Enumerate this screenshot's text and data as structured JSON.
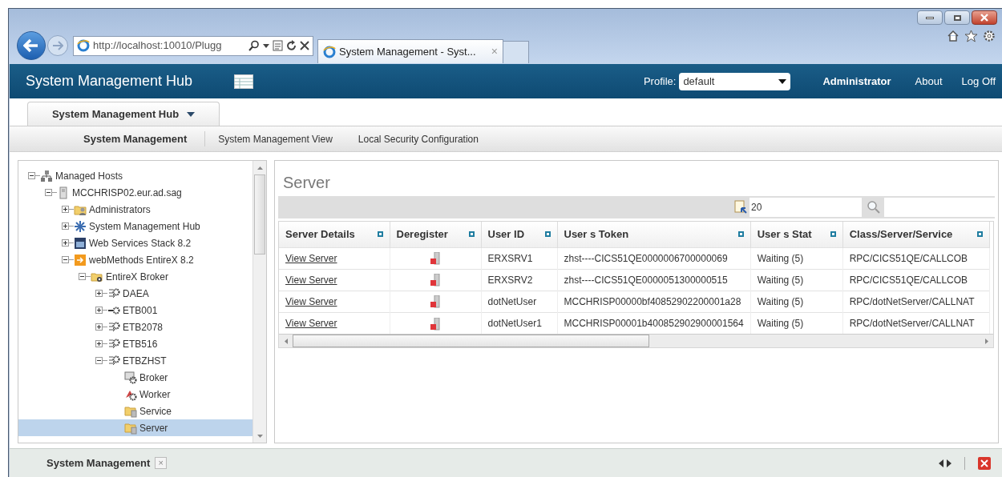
{
  "browser": {
    "address": "http://localhost:10010/Plugg",
    "tab_title": "System Management - Syst...",
    "tab_close": "×"
  },
  "header": {
    "title": "System Management Hub",
    "profile_label": "Profile:",
    "profile_value": "default",
    "user": "Administrator",
    "links": [
      "About",
      "Log Off"
    ]
  },
  "hub_tab": {
    "label": "System Management Hub"
  },
  "nav": [
    {
      "label": "System Management",
      "selected": true
    },
    {
      "label": "System Management View",
      "selected": false
    },
    {
      "label": "Local Security Configuration",
      "selected": false
    }
  ],
  "tree": [
    {
      "label": "Managed Hosts",
      "kind": "hosts",
      "expanded": true,
      "selected": false,
      "children": [
        {
          "label": "MCCHRISP02.eur.ad.sag",
          "kind": "machine",
          "expanded": true,
          "selected": false,
          "children": [
            {
              "label": "Administrators",
              "kind": "admins",
              "expanded": false,
              "selected": false
            },
            {
              "label": "System Management Hub",
              "kind": "hub",
              "expanded": false,
              "selected": false
            },
            {
              "label": "Web Services Stack 8.2",
              "kind": "stack",
              "expanded": false,
              "selected": false
            },
            {
              "label": "webMethods EntireX 8.2",
              "kind": "product",
              "expanded": true,
              "selected": false,
              "children": [
                {
                  "label": "EntireX Broker",
                  "kind": "broker-folder",
                  "expanded": true,
                  "selected": false,
                  "children": [
                    {
                      "label": "DAEA",
                      "kind": "broker",
                      "expanded": false,
                      "selected": false
                    },
                    {
                      "label": "ETB001",
                      "kind": "broker-off",
                      "expanded": false,
                      "selected": false
                    },
                    {
                      "label": "ETB2078",
                      "kind": "broker",
                      "expanded": false,
                      "selected": false
                    },
                    {
                      "label": "ETB516",
                      "kind": "broker",
                      "expanded": false,
                      "selected": false
                    },
                    {
                      "label": "ETBZHST",
                      "kind": "broker",
                      "expanded": true,
                      "selected": false,
                      "children": [
                        {
                          "label": "Broker",
                          "kind": "broker-leaf",
                          "selected": false
                        },
                        {
                          "label": "Worker",
                          "kind": "worker",
                          "selected": false
                        },
                        {
                          "label": "Service",
                          "kind": "folder",
                          "selected": false
                        },
                        {
                          "label": "Server",
                          "kind": "folder",
                          "selected": true
                        }
                      ]
                    }
                  ]
                }
              ]
            }
          ]
        }
      ]
    }
  ],
  "content": {
    "title": "Server",
    "page_size": "20",
    "columns": [
      "Server Details",
      "Deregister",
      "User ID",
      "User s Token",
      "User s Stat",
      "Class/Server/Service"
    ],
    "rows": [
      {
        "details": "View Server",
        "user_id": "ERXSRV1",
        "token": "zhst----CICS51QE0000006700000069",
        "status": "Waiting (5)",
        "service": "RPC/CICS51QE/CALLCOB"
      },
      {
        "details": "View Server",
        "user_id": "ERXSRV2",
        "token": "zhst----CICS51QE0000051300000515",
        "status": "Waiting (5)",
        "service": "RPC/CICS51QE/CALLCOB"
      },
      {
        "details": "View Server",
        "user_id": "dotNetUser",
        "token": "MCCHRISP00000bf40852902200001a28",
        "status": "Waiting (5)",
        "service": "RPC/dotNetServer/CALLNAT"
      },
      {
        "details": "View Server",
        "user_id": "dotNetUser1",
        "token": "MCCHRISP00001b400852902900001564",
        "status": "Waiting (5)",
        "service": "RPC/dotNetServer/CALLNAT"
      }
    ]
  },
  "bottom": {
    "label": "System Management",
    "close": "×"
  }
}
